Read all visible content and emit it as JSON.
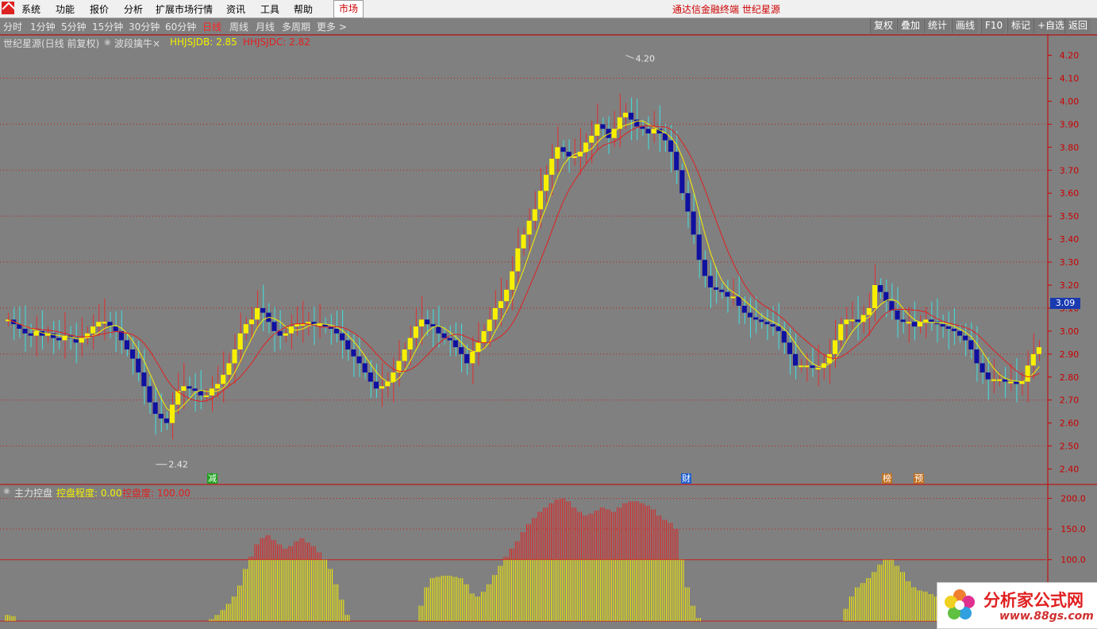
{
  "menubar": {
    "items": [
      "系统",
      "功能",
      "报价",
      "分析",
      "扩展市场行情",
      "资讯",
      "工具",
      "帮助"
    ],
    "market_button": "市场",
    "title": "通达信金融终端  世纪星源"
  },
  "periods": {
    "items": [
      "分时",
      "1分钟",
      "5分钟",
      "15分钟",
      "30分钟",
      "60分钟",
      "日线",
      "周线",
      "月线",
      "多周期",
      "更多 >"
    ],
    "active": "日线"
  },
  "toolbar": [
    "复权",
    "叠加",
    "统计",
    "画线",
    "F10",
    "标记",
    "+自选",
    "返回"
  ],
  "main_legend": {
    "stock": "世纪星源(日线 前复权)",
    "indicator": "波段擒牛×",
    "ind1_label": "HHJSJDB: 2.85",
    "ind2_label": "HHJSJDC: 2.82"
  },
  "sub_legend": {
    "name": "主力控盘",
    "ind1_label": "控盘程度: 0.00",
    "ind2_label": "控盘度: 100.00"
  },
  "price_axis": {
    "ticks": [
      "4.20",
      "4.10",
      "4.00",
      "3.90",
      "3.80",
      "3.70",
      "3.60",
      "3.50",
      "3.40",
      "3.30",
      "3.20",
      "3.10",
      "3.00",
      "2.90",
      "2.80",
      "2.70",
      "2.60",
      "2.50",
      "2.40"
    ],
    "current_price": "3.09",
    "high_mark": "4.20",
    "low_mark": "2.42"
  },
  "sub_axis": {
    "ticks": [
      "200.0",
      "150.0",
      "100.0"
    ]
  },
  "events": [
    {
      "label": "减",
      "color": "#1aa01a"
    },
    {
      "label": "财",
      "color": "#2060d0"
    },
    {
      "label": "榜",
      "color": "#c07020"
    },
    {
      "label": "预",
      "color": "#c07020"
    }
  ],
  "watermark": {
    "title": "分析家公式网",
    "url": "www.88gs.com"
  },
  "chart_data": {
    "type": "candlestick",
    "y_range": [
      2.35,
      4.24
    ],
    "closes": [
      3.05,
      3.03,
      3.01,
      2.99,
      2.98,
      3.0,
      2.98,
      2.99,
      2.97,
      2.96,
      2.98,
      2.97,
      2.95,
      2.97,
      2.99,
      3.02,
      3.04,
      3.04,
      3.02,
      3.0,
      2.96,
      2.92,
      2.88,
      2.82,
      2.76,
      2.69,
      2.64,
      2.62,
      2.6,
      2.68,
      2.74,
      2.76,
      2.75,
      2.74,
      2.72,
      2.72,
      2.75,
      2.77,
      2.81,
      2.86,
      2.92,
      2.99,
      3.03,
      3.05,
      3.1,
      3.08,
      3.04,
      3.0,
      2.98,
      2.99,
      3.02,
      3.03,
      3.03,
      3.04,
      3.03,
      3.03,
      3.02,
      3.01,
      2.99,
      2.96,
      2.92,
      2.89,
      2.86,
      2.82,
      2.78,
      2.75,
      2.76,
      2.78,
      2.82,
      2.87,
      2.92,
      2.97,
      3.02,
      3.05,
      3.03,
      3.02,
      2.99,
      2.97,
      2.96,
      2.93,
      2.9,
      2.86,
      2.91,
      2.95,
      3.0,
      3.05,
      3.1,
      3.13,
      3.18,
      3.26,
      3.36,
      3.42,
      3.48,
      3.53,
      3.61,
      3.68,
      3.75,
      3.8,
      3.78,
      3.76,
      3.76,
      3.78,
      3.82,
      3.85,
      3.9,
      3.88,
      3.84,
      3.88,
      3.93,
      3.95,
      3.92,
      3.89,
      3.88,
      3.86,
      3.88,
      3.86,
      3.83,
      3.78,
      3.7,
      3.6,
      3.52,
      3.42,
      3.31,
      3.24,
      3.19,
      3.18,
      3.17,
      3.15,
      3.15,
      3.11,
      3.08,
      3.06,
      3.05,
      3.04,
      3.03,
      3.02,
      3.0,
      2.95,
      2.9,
      2.85,
      2.85,
      2.85,
      2.84,
      2.84,
      2.86,
      2.9,
      2.96,
      3.03,
      3.05,
      3.05,
      3.04,
      3.07,
      3.1,
      3.2,
      3.17,
      3.13,
      3.09,
      3.05,
      3.04,
      3.04,
      3.02,
      3.04,
      3.05,
      3.04,
      3.03,
      3.02,
      3.01,
      3.0,
      2.98,
      2.96,
      2.92,
      2.86,
      2.82,
      2.79,
      2.79,
      2.79,
      2.78,
      2.78,
      2.77,
      2.78,
      2.85,
      2.9,
      2.93
    ],
    "kongpan": [
      10,
      8,
      0,
      0,
      0,
      0,
      0,
      0,
      0,
      0,
      0,
      0,
      0,
      0,
      0,
      0,
      0,
      0,
      0,
      0,
      0,
      0,
      0,
      0,
      0,
      0,
      0,
      0,
      0,
      0,
      0,
      0,
      0,
      0,
      0,
      0,
      3,
      10,
      18,
      28,
      40,
      58,
      85,
      105,
      125,
      135,
      140,
      132,
      125,
      118,
      122,
      130,
      135,
      128,
      122,
      112,
      100,
      85,
      60,
      35,
      10,
      0,
      0,
      0,
      0,
      0,
      0,
      0,
      0,
      0,
      0,
      0,
      0,
      25,
      55,
      70,
      72,
      74,
      74,
      72,
      70,
      60,
      45,
      40,
      48,
      60,
      75,
      90,
      105,
      118,
      130,
      145,
      158,
      168,
      178,
      185,
      192,
      198,
      200,
      195,
      185,
      178,
      172,
      175,
      180,
      185,
      182,
      178,
      185,
      192,
      195,
      195,
      192,
      188,
      182,
      172,
      165,
      160,
      150,
      100,
      55,
      25,
      5,
      0,
      0,
      0,
      0,
      0,
      0,
      0,
      0,
      0,
      0,
      0,
      0,
      0,
      0,
      0,
      0,
      0,
      0,
      0,
      0,
      0,
      0,
      0,
      0,
      0,
      20,
      40,
      55,
      62,
      70,
      80,
      92,
      100,
      100,
      90,
      80,
      65,
      55,
      50,
      48,
      44,
      40,
      35,
      30,
      25,
      20,
      15,
      10,
      5,
      0,
      0,
      0,
      0,
      0,
      0,
      0,
      0
    ]
  }
}
